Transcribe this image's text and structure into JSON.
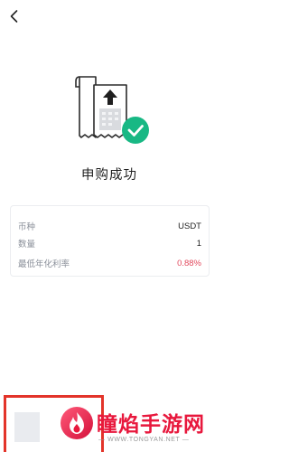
{
  "nav": {
    "back_icon": "chevron-left-icon"
  },
  "result": {
    "icon": "receipt-success-icon",
    "status_color": "#18b884",
    "title": "申购成功"
  },
  "details": [
    {
      "label": "币种",
      "value": "USDT"
    },
    {
      "label": "数量",
      "value": "1"
    },
    {
      "label": "最低年化利率",
      "value": "0.88%",
      "value_color": "#e24a5e"
    }
  ],
  "watermark": {
    "name": "瞳焰手游网",
    "url": "— WWW.TONGYAN.NET —",
    "color": "#e8183d"
  }
}
